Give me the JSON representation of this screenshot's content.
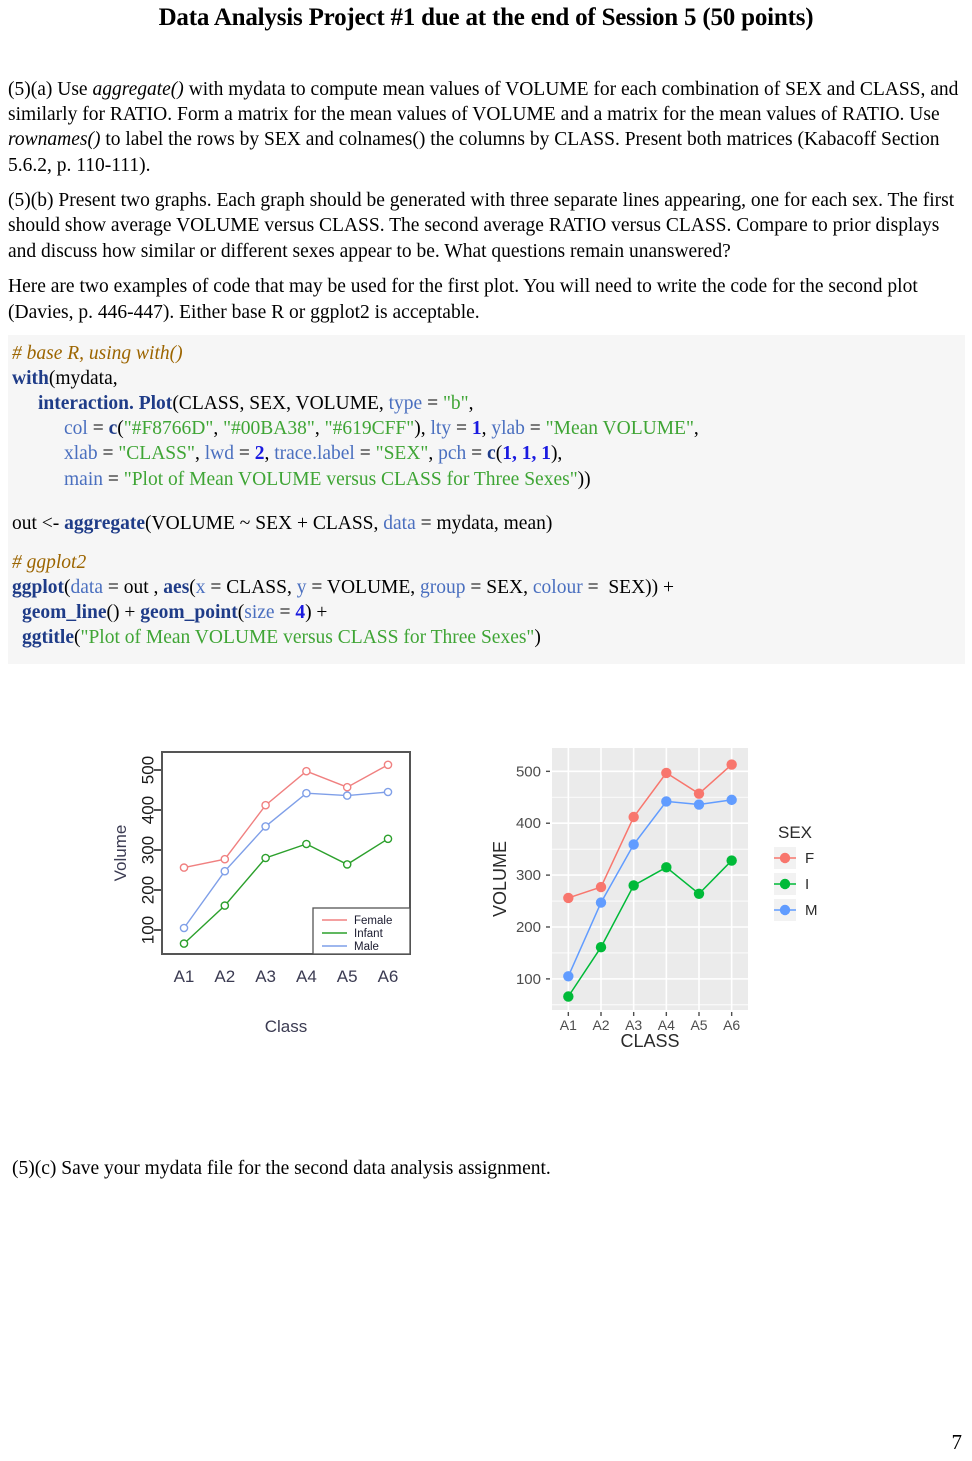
{
  "document": {
    "title": "Data Analysis Project #1 due at the end of Session 5 (50 points)",
    "page_number": "7"
  },
  "paragraphs": {
    "p5a": "(5)(a) Use aggregate() with mydata to compute mean values of VOLUME for each combination of SEX and CLASS, and similarly for RATIO. Form a matrix for the mean values of VOLUME and a matrix for the mean values of RATIO. Use rownames() to label the rows by SEX and colnames() the columns by CLASS. Present both matrices (Kabacoff Section 5.6.2, p. 110-111).",
    "p5a_parts": {
      "a1": "(5)(a) Use ",
      "a2": "aggregate()",
      "a3": " with mydata to compute mean values of VOLUME for each combination of SEX and CLASS, and similarly for RATIO. Form a matrix for the mean values of VOLUME and a matrix for the mean values of RATIO. Use ",
      "a4": "rownames()",
      "a5": " to label the rows by SEX and colnames() the columns by CLASS. Present both matrices (Kabacoff Section 5.6.2, p. 110-111)."
    },
    "p5b": "(5)(b) Present two graphs. Each graph should be generated with three separate lines appearing, one for each sex. The first should show average VOLUME versus CLASS. The second average RATIO versus CLASS. Compare to prior displays and discuss how similar or different sexes appear to be. What questions remain unanswered?",
    "p_intro_code": "Here are two examples of code that may be used for the first plot. You will need to write the code for the second plot (Davies, p. 446-447). Either base R or ggplot2 is acceptable.",
    "p5c": " (5)(c)  Save your mydata file for the second data analysis assignment."
  },
  "code": {
    "comment1": "# base R, using with()",
    "line_with_fn": "with",
    "line_with_rest": "(mydata,",
    "l3_fn": "interaction. Plot",
    "l3_a": "(CLASS, SEX, VOLUME, ",
    "l3_arg": "type",
    "l3_b": " = ",
    "l3_str": "\"b\"",
    "l3_c": ",",
    "l4_arg1": "col",
    "l4_eq": " = ",
    "l4_c": "c",
    "l4_open": "(",
    "l4_s1": "\"#F8766D\"",
    "l4_s2": "\"#00BA38\"",
    "l4_s3": "\"#619CFF\"",
    "l4_arg2": "lty",
    "l4_n1": "1",
    "l4_arg3": "ylab",
    "l4_s4": "\"Mean VOLUME\"",
    "l5_arg1": "xlab",
    "l5_s1": "\"CLASS\"",
    "l5_arg2": "lwd",
    "l5_n1": "2",
    "l5_arg3": "trace.label",
    "l5_s2": "\"SEX\"",
    "l5_arg4": "pch",
    "l5_c": "c",
    "l5_nums": "1, 1, 1",
    "l6_arg": "main",
    "l6_str": "\"Plot of Mean VOLUME versus CLASS for Three Sexes\"",
    "l6_close": "))",
    "out_pre": "out <- ",
    "out_fn": "aggregate",
    "out_a": "(VOLUME ~ SEX + CLASS, ",
    "out_arg": "data",
    "out_b": " = mydata, mean)",
    "comment2": "# ggplot2",
    "gg_fn": "ggplot",
    "gg_open": "(",
    "gg_arg_data": "data",
    "gg_out": " = out , ",
    "gg_aes": "aes",
    "gg_x": "x",
    "gg_class": " = CLASS, ",
    "gg_y": "y",
    "gg_volume": " = VOLUME, ",
    "gg_group": "group",
    "gg_sex1": " = SEX, ",
    "gg_colour": "colour",
    "gg_sex2": " =  SEX)) +",
    "gl_line": "geom_line",
    "gl_line_a": "() + ",
    "gl_point": "geom_point",
    "gl_point_a": "(",
    "gl_size": "size",
    "gl_eq": " = ",
    "gl_4": "4",
    "gl_tail": ") +",
    "ggt_fn": "ggtitle",
    "ggt_open": "(",
    "ggt_str": "\"Plot of Mean VOLUME versus CLASS for Three Sexes\"",
    "ggt_close": ")"
  },
  "colors": {
    "female": "#F8766D",
    "infant": "#00BA38",
    "male": "#619CFF",
    "base_female": "#f08080",
    "base_infant": "#2ca02c",
    "base_male": "#7f9fe8",
    "panel_bg": "#ebebeb",
    "code_bg": "#f6f6f6"
  },
  "chart_data": [
    {
      "id": "base-r-interaction-plot",
      "type": "line",
      "title": "",
      "xlabel": "Class",
      "ylabel": "Volume",
      "categories": [
        "A1",
        "A2",
        "A3",
        "A4",
        "A5",
        "A6"
      ],
      "yticks": [
        100,
        200,
        300,
        400,
        500
      ],
      "ylim": [
        40,
        545
      ],
      "grid": false,
      "legend_position": "bottom-right",
      "legend_title": "",
      "series": [
        {
          "name": "Female",
          "color": "#f08080",
          "values": [
            256,
            277,
            412,
            497,
            457,
            513
          ]
        },
        {
          "name": "Infant",
          "color": "#2ca02c",
          "values": [
            66,
            161,
            280,
            315,
            264,
            328
          ]
        },
        {
          "name": "Male",
          "color": "#7f9fe8",
          "values": [
            105,
            247,
            359,
            442,
            436,
            445
          ]
        }
      ]
    },
    {
      "id": "ggplot2-volume-vs-class",
      "type": "line",
      "title": "",
      "xlabel": "CLASS",
      "ylabel": "VOLUME",
      "categories": [
        "A1",
        "A2",
        "A3",
        "A4",
        "A5",
        "A6"
      ],
      "yticks": [
        100,
        200,
        300,
        400,
        500
      ],
      "ylim": [
        40,
        545
      ],
      "grid": true,
      "legend_position": "right",
      "legend_title": "SEX",
      "series": [
        {
          "name": "F",
          "color": "#F8766D",
          "values": [
            256,
            277,
            412,
            497,
            457,
            513
          ]
        },
        {
          "name": "I",
          "color": "#00BA38",
          "values": [
            66,
            161,
            280,
            315,
            264,
            328
          ]
        },
        {
          "name": "M",
          "color": "#619CFF",
          "values": [
            105,
            247,
            359,
            442,
            436,
            445
          ]
        }
      ]
    }
  ]
}
